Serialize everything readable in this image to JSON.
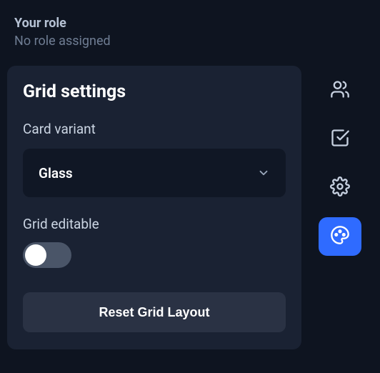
{
  "role": {
    "title": "Your role",
    "value": "No role assigned"
  },
  "grid_settings": {
    "title": "Grid settings",
    "card_variant_label": "Card variant",
    "card_variant_value": "Glass",
    "grid_editable_label": "Grid editable",
    "grid_editable_value": false,
    "reset_label": "Reset Grid Layout"
  },
  "rail": {
    "items": [
      {
        "name": "people",
        "active": false
      },
      {
        "name": "tasks",
        "active": false
      },
      {
        "name": "settings",
        "active": false
      },
      {
        "name": "theme",
        "active": true
      }
    ]
  },
  "colors": {
    "bg": "#0e1420",
    "card": "#1a2233",
    "select": "#101725",
    "accent": "#2f6bff",
    "muted": "#6f7d93"
  }
}
